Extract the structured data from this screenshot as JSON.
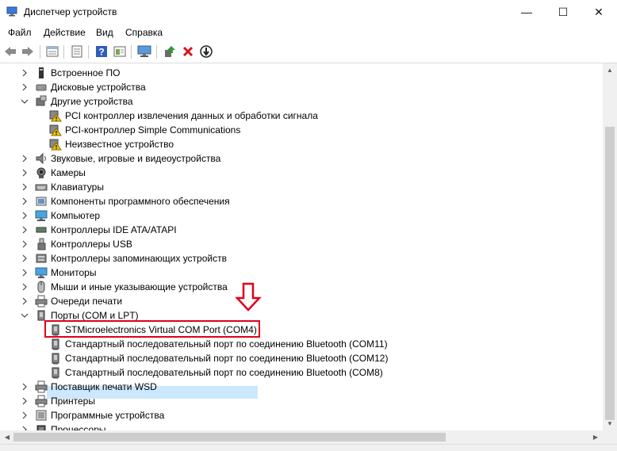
{
  "window": {
    "title": "Диспетчер устройств",
    "minimize": "—",
    "maximize": "☐",
    "close": "✕"
  },
  "menu": [
    "Файл",
    "Действие",
    "Вид",
    "Справка"
  ],
  "toolbar": [
    "back-icon",
    "forward-icon",
    "properties-icon",
    "details-icon",
    "help-icon",
    "view-icon",
    "monitor-icon",
    "update-driver-icon",
    "uninstall-icon",
    "disable-icon"
  ],
  "tree": {
    "rows": [
      {
        "label": "Встроенное ПО",
        "icon": "firmware-icon",
        "expand": "collapsed",
        "level": 0
      },
      {
        "label": "Дисковые устройства",
        "icon": "disk-icon",
        "expand": "collapsed",
        "level": 0
      },
      {
        "label": "Другие устройства",
        "icon": "other-devices-icon",
        "expand": "expanded",
        "level": 0
      },
      {
        "label": "PCI контроллер извлечения данных и обработки сигнала",
        "icon": "warning-device-icon",
        "expand": "none",
        "level": 1
      },
      {
        "label": "PCI-контроллер Simple Communications",
        "icon": "warning-device-icon",
        "expand": "none",
        "level": 1
      },
      {
        "label": "Неизвестное устройство",
        "icon": "warning-device-icon",
        "expand": "none",
        "level": 1
      },
      {
        "label": "Звуковые, игровые и видеоустройства",
        "icon": "speaker-icon",
        "expand": "collapsed",
        "level": 0
      },
      {
        "label": "Камеры",
        "icon": "camera-icon",
        "expand": "collapsed",
        "level": 0
      },
      {
        "label": "Клавиатуры",
        "icon": "keyboard-icon",
        "expand": "collapsed",
        "level": 0
      },
      {
        "label": "Компоненты программного обеспечения",
        "icon": "software-icon",
        "expand": "collapsed",
        "level": 0
      },
      {
        "label": "Компьютер",
        "icon": "computer-icon",
        "expand": "collapsed",
        "level": 0
      },
      {
        "label": "Контроллеры IDE ATA/ATAPI",
        "icon": "ide-icon",
        "expand": "collapsed",
        "level": 0
      },
      {
        "label": "Контроллеры USB",
        "icon": "usb-icon",
        "expand": "collapsed",
        "level": 0
      },
      {
        "label": "Контроллеры запоминающих устройств",
        "icon": "storage-icon",
        "expand": "collapsed",
        "level": 0
      },
      {
        "label": "Мониторы",
        "icon": "monitor-icon",
        "expand": "collapsed",
        "level": 0
      },
      {
        "label": "Мыши и иные указывающие устройства",
        "icon": "mouse-icon",
        "expand": "collapsed",
        "level": 0
      },
      {
        "label": "Очереди печати",
        "icon": "print-queue-icon",
        "expand": "collapsed",
        "level": 0
      },
      {
        "label": "Порты (COM и LPT)",
        "icon": "port-icon",
        "expand": "expanded",
        "level": 0
      },
      {
        "label": "STMicroelectronics Virtual COM Port (COM4)",
        "icon": "com-port-icon",
        "expand": "none",
        "level": 1,
        "selected": true
      },
      {
        "label": "Стандартный последовательный порт по соединению Bluetooth (COM11)",
        "icon": "com-port-icon",
        "expand": "none",
        "level": 1
      },
      {
        "label": "Стандартный последовательный порт по соединению Bluetooth (COM12)",
        "icon": "com-port-icon",
        "expand": "none",
        "level": 1
      },
      {
        "label": "Стандартный последовательный порт по соединению Bluetooth (COM8)",
        "icon": "com-port-icon",
        "expand": "none",
        "level": 1
      },
      {
        "label": "Поставщик печати WSD",
        "icon": "printer-icon",
        "expand": "collapsed",
        "level": 0
      },
      {
        "label": "Принтеры",
        "icon": "printer-icon",
        "expand": "collapsed",
        "level": 0
      },
      {
        "label": "Программные устройства",
        "icon": "software-device-icon",
        "expand": "collapsed",
        "level": 0
      },
      {
        "label": "Процессоры",
        "icon": "processor-icon",
        "expand": "collapsed",
        "level": 0
      }
    ]
  },
  "colors": {
    "highlight_border": "#e0001b",
    "selection": "#cce8ff",
    "warning": "#f5c400"
  }
}
